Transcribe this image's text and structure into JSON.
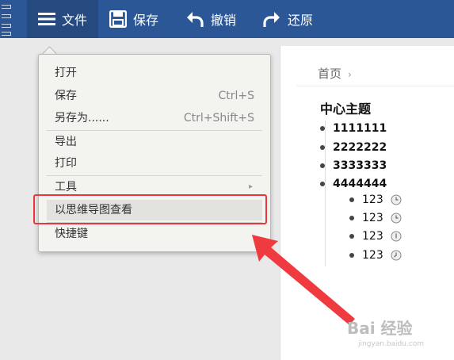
{
  "toolbar": {
    "file_label": "文件",
    "save_label": "保存",
    "undo_label": "撤销",
    "redo_label": "还原"
  },
  "menu": {
    "items": [
      {
        "label": "打开",
        "shortcut": ""
      },
      {
        "label": "保存",
        "shortcut": "Ctrl+S"
      },
      {
        "label": "另存为......",
        "shortcut": "Ctrl+Shift+S"
      },
      {
        "label": "导出",
        "shortcut": ""
      },
      {
        "label": "打印",
        "shortcut": ""
      },
      {
        "label": "工具",
        "shortcut": ""
      },
      {
        "label": "以思维导图查看",
        "shortcut": ""
      },
      {
        "label": "快捷键",
        "shortcut": ""
      }
    ]
  },
  "panel": {
    "breadcrumb": "首页",
    "topic": "中心主题",
    "nodes": [
      "1111111",
      "2222222",
      "3333333",
      "4444444"
    ],
    "subnodes": [
      "123",
      "123",
      "123",
      "123"
    ]
  },
  "watermark": {
    "brand": "Bai 经验",
    "url": "jingyan.baidu.com"
  },
  "colors": {
    "toolbar_bg": "#2b5797",
    "highlight_border": "#e8383d",
    "arrow": "#ef3b3f"
  }
}
